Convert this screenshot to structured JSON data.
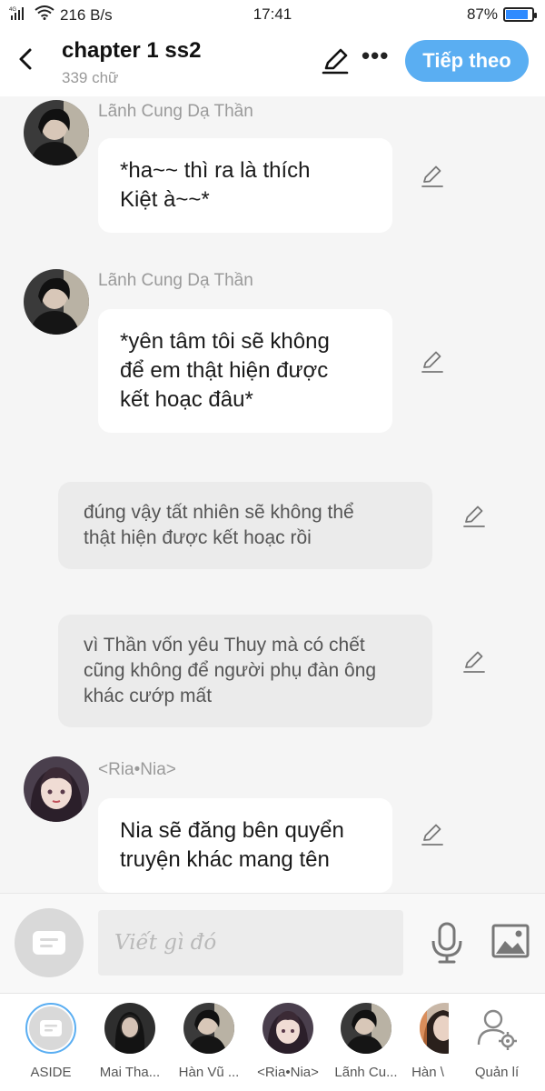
{
  "status_bar": {
    "network": "4G",
    "speed": "216 B/s",
    "time": "17:41",
    "battery": "87%",
    "battery_level": 0.87
  },
  "header": {
    "title": "chapter 1 ss2",
    "word_count": "339 chữ",
    "next_label": "Tiếp theo",
    "more_label": "•••"
  },
  "messages": [
    {
      "type": "character",
      "sender": "Lãnh Cung Dạ Thần",
      "avatar": "dark-hair-portrait",
      "lines": [
        "*ha~~ thì ra là thích",
        "Kiệt à~~*"
      ]
    },
    {
      "type": "character",
      "sender": "Lãnh Cung Dạ Thần",
      "avatar": "dark-hair-portrait",
      "lines": [
        "*yên tâm tôi sẽ không",
        "để em thật hiện được",
        "kết hoạc đâu*"
      ]
    },
    {
      "type": "aside",
      "lines": [
        "đúng vậy tất nhiên sẽ không thể",
        "thật hiện được kết hoạc rồi"
      ]
    },
    {
      "type": "aside",
      "lines": [
        "vì Thần vốn yêu Thuy mà có chết",
        "cũng không để người phụ đàn ông",
        "khác cướp mất"
      ]
    },
    {
      "type": "character",
      "sender": "<Ria•Nia>",
      "avatar": "anime-girl-portrait",
      "lines": [
        "Nia sẽ đăng bên quyển",
        "truyện khác mang tên"
      ]
    }
  ],
  "composer": {
    "placeholder": "Viết gì đó"
  },
  "characters": [
    {
      "label": "ASIDE",
      "avatar": "aside-icon",
      "selected": true
    },
    {
      "label": "Mai Tha...",
      "avatar": "girl-portrait"
    },
    {
      "label": "Hàn Vũ ...",
      "avatar": "dark-hair-portrait"
    },
    {
      "label": "<Ria•Nia>",
      "avatar": "anime-girl-portrait"
    },
    {
      "label": "Lãnh Cu...",
      "avatar": "dark-hair-portrait"
    },
    {
      "label": "Hàn \\",
      "avatar": "girl-portrait"
    },
    {
      "label": "Quản lí",
      "avatar": "manage-icon"
    }
  ],
  "colors": {
    "accent": "#5aaef2",
    "background": "#f5f5f5",
    "aside_bubble": "#ebebeb"
  }
}
